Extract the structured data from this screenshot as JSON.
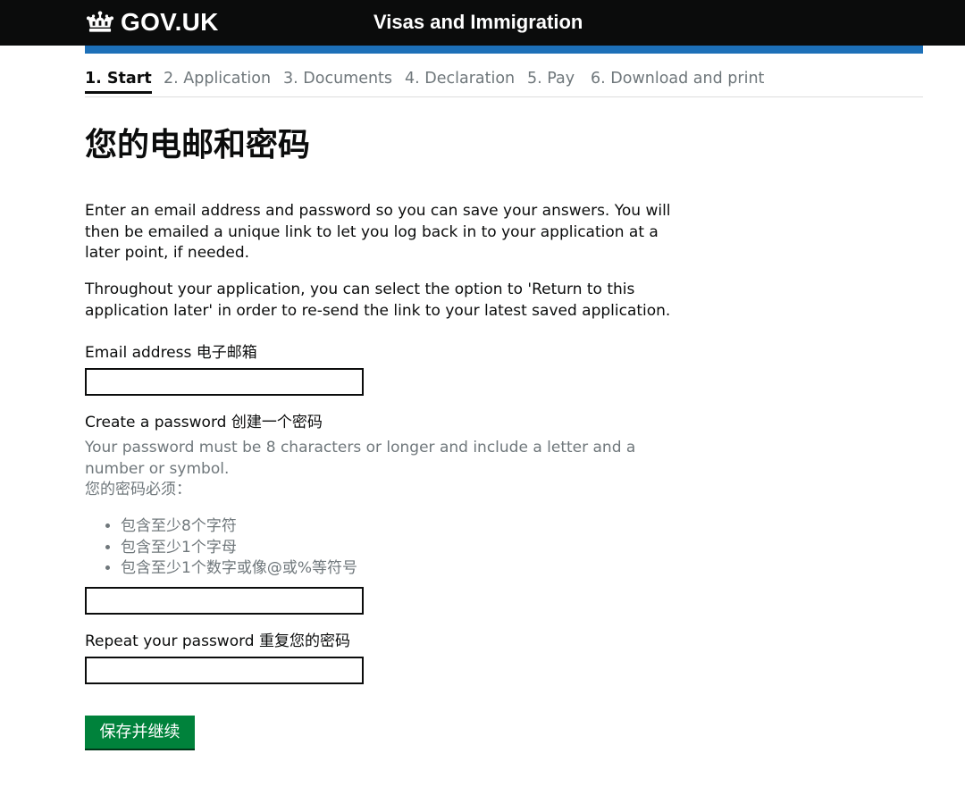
{
  "header": {
    "logo_text": "GOV.UK",
    "service_name": "Visas and Immigration"
  },
  "progress": {
    "steps": [
      {
        "label": "1. Start",
        "active": true
      },
      {
        "label": "2. Application",
        "active": false
      },
      {
        "label": "3. Documents",
        "active": false
      },
      {
        "label": "4. Declaration",
        "active": false
      },
      {
        "label": "5. Pay",
        "active": false
      },
      {
        "label": "6. Download and print",
        "active": false
      }
    ]
  },
  "main": {
    "title": "您的电邮和密码",
    "intro": "Enter an email address and password so you can save your answers. You will then be emailed a unique link to let you log back in to your application at a later point, if needed.",
    "intro2": "Throughout your application, you can select the option to 'Return to this application later' in order to re-send the link to your latest saved application."
  },
  "form": {
    "email": {
      "label": "Email address 电子邮箱",
      "value": ""
    },
    "password": {
      "label": "Create a password 创建一个密码",
      "hint": "Your password must be 8 characters or longer and include a letter and a number or symbol.",
      "hint_zh": "您的密码必须：",
      "rules": [
        "包含至少8个字符",
        "包含至少1个字母",
        "包含至少1个数字或像@或%等符号"
      ],
      "value": ""
    },
    "repeat_password": {
      "label": "Repeat your password 重复您的密码",
      "value": ""
    },
    "submit_label": "保存并继续"
  },
  "colors": {
    "header_bg": "#0b0c0c",
    "accent_blue": "#1d70b8",
    "button_green": "#00823b",
    "hint_grey": "#6f777b"
  },
  "icons": {
    "logo": "crown-icon"
  }
}
